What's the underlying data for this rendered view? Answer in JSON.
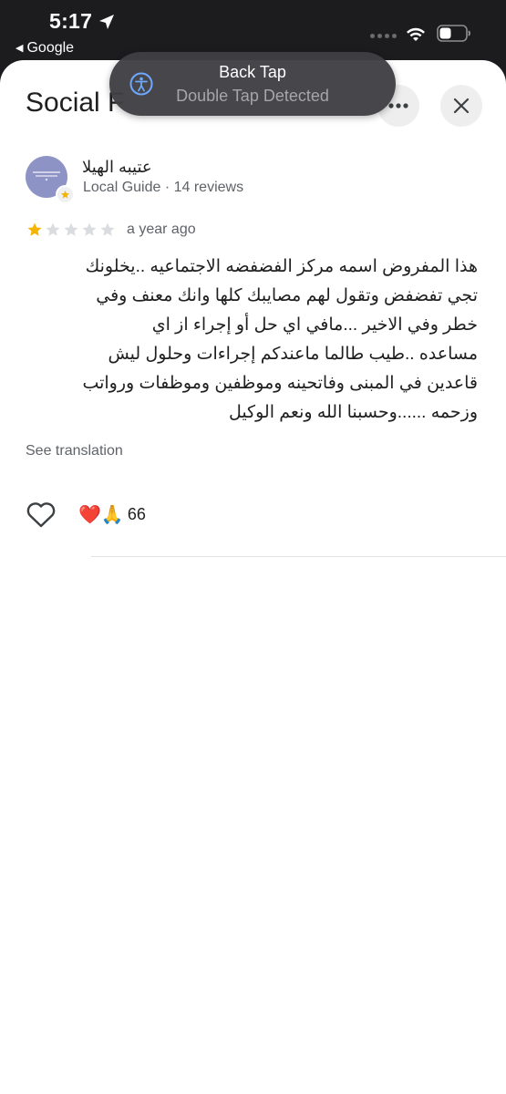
{
  "status_bar": {
    "time": "5:17",
    "back_app": "Google",
    "icons": [
      "location-arrow-icon",
      "cellular-signal-icon",
      "wifi-icon",
      "battery-icon"
    ]
  },
  "header": {
    "title": "Social F",
    "more_icon": "more-horizontal-icon",
    "close_icon": "close-icon"
  },
  "toast": {
    "title": "Back Tap",
    "subtitle": "Double Tap Detected",
    "icon": "accessibility-icon"
  },
  "review": {
    "reviewer_name": "عتيبه الهيلا",
    "reviewer_meta": "Local Guide · 14 reviews",
    "rating": 1,
    "max_rating": 5,
    "date": "a year ago",
    "text_lines": [
      "هذا المفروض اسمه مركز الفضفضه  الاجتماعيه ..يخلونك",
      "تجي تفضفض وتقول لهم مصايبك كلها وانك معنف وفي",
      "خطر وفي الاخير ...مافي اي حل أو إجراء از اي",
      "مساعده ..طيب طالما ماعندكم إجراءات وحلول  ليش",
      "قاعدين في المبنى وفاتحينه وموظفين وموظفات ورواتب",
      "وزحمه  ......وحسبنا الله ونعم الوكيل"
    ],
    "see_translation": "See translation",
    "reactions_emoji": "❤️🙏",
    "reactions_count": "66"
  },
  "colors": {
    "star_filled": "#f4b400",
    "star_empty": "#dadce0",
    "avatar_bg": "#8e93c6",
    "toast_bg": "#404044"
  }
}
